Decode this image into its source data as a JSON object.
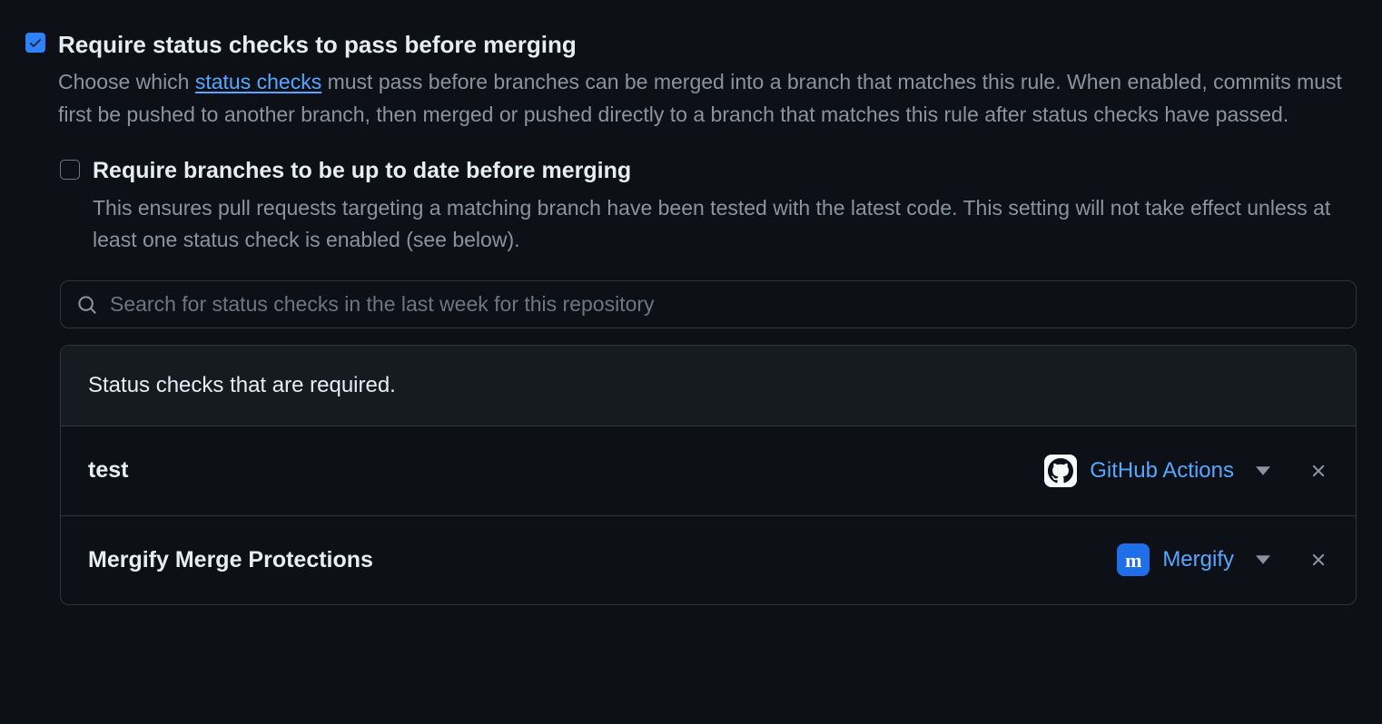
{
  "main": {
    "title": "Require status checks to pass before merging",
    "desc_pre": "Choose which ",
    "desc_link": "status checks",
    "desc_post": " must pass before branches can be merged into a branch that matches this rule. When enabled, commits must first be pushed to another branch, then merged or pushed directly to a branch that matches this rule after status checks have passed."
  },
  "sub": {
    "title": "Require branches to be up to date before merging",
    "desc": "This ensures pull requests targeting a matching branch have been tested with the latest code. This setting will not take effect unless at least one status check is enabled (see below)."
  },
  "search": {
    "placeholder": "Search for status checks in the last week for this repository"
  },
  "panel": {
    "header": "Status checks that are required.",
    "checks": [
      {
        "name": "test",
        "source_label": "GitHub Actions",
        "source_kind": "gh"
      },
      {
        "name": "Mergify Merge Protections",
        "source_label": "Mergify",
        "source_kind": "mergify"
      }
    ]
  }
}
